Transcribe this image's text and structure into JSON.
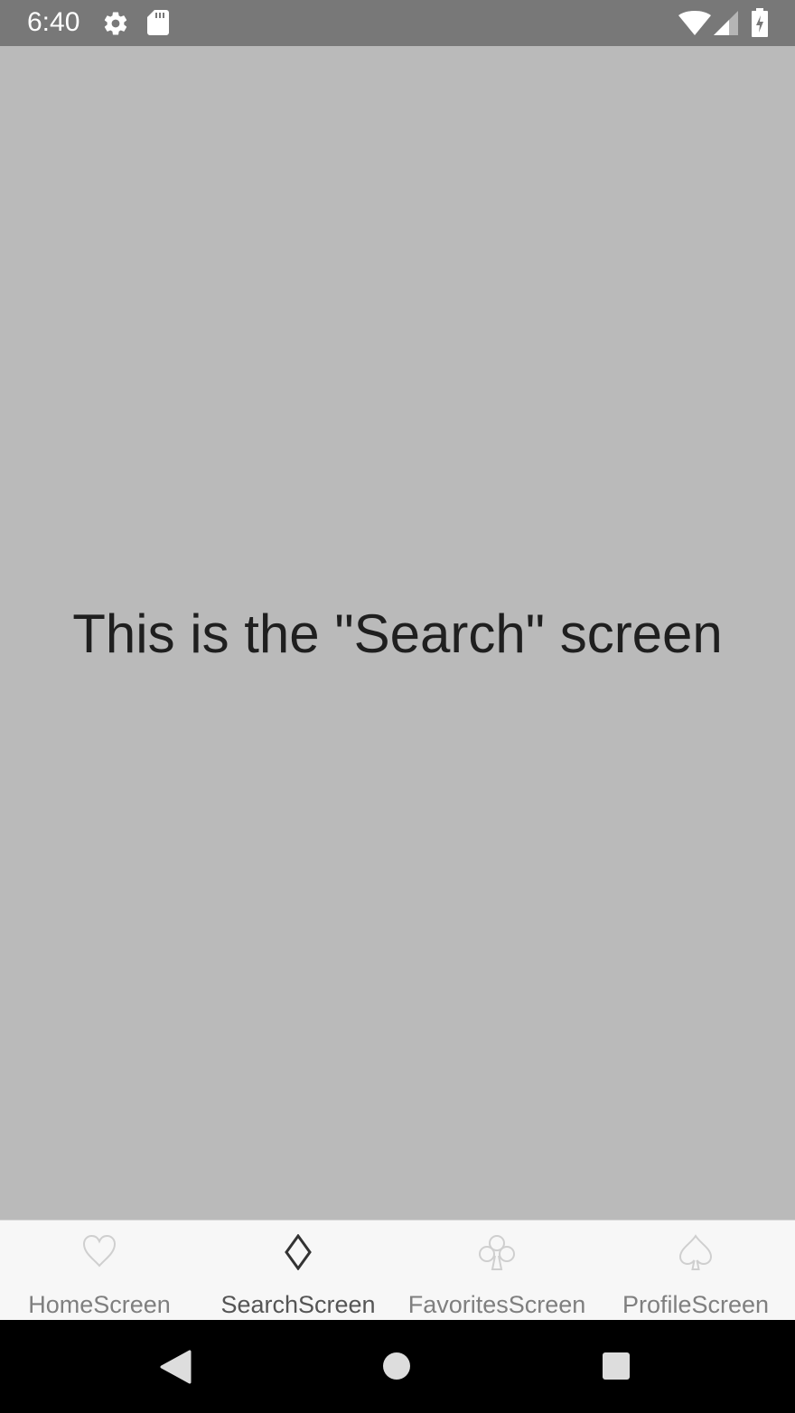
{
  "status_bar": {
    "time": "6:40",
    "icons": [
      "gear-icon",
      "sd-card-icon",
      "wifi-icon",
      "cell-signal-icon",
      "battery-charging-icon"
    ]
  },
  "main": {
    "text": "This is the \"Search\" screen"
  },
  "tab_bar": {
    "tabs": [
      {
        "label": "HomeScreen",
        "icon": "heart-outline-icon",
        "active": false
      },
      {
        "label": "SearchScreen",
        "icon": "diamond-outline-icon",
        "active": true
      },
      {
        "label": "FavoritesScreen",
        "icon": "club-outline-icon",
        "active": false
      },
      {
        "label": "ProfileScreen",
        "icon": "spade-outline-icon",
        "active": false
      }
    ]
  },
  "nav_bar": {
    "buttons": [
      "back-icon",
      "home-icon",
      "recents-icon"
    ]
  },
  "colors": {
    "status_bar": "#787878",
    "background": "#bababa",
    "tab_bar": "#f7f7f7",
    "tab_active": "#555555",
    "tab_inactive": "#7f7f7f",
    "nav_bar": "#000000"
  }
}
